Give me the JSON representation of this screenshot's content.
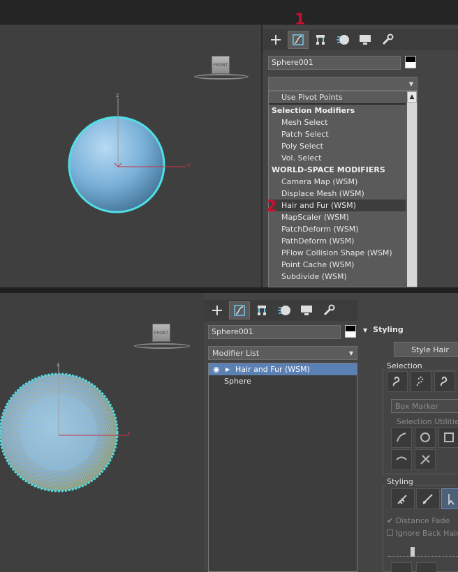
{
  "top": {
    "view_cube_label": "FRONT",
    "axis": {
      "z": "z",
      "x": "x"
    },
    "object_name": "Sphere001",
    "modifier_dropdown_value": "",
    "modifier_list": {
      "items": [
        {
          "label": "Use Pivot Points",
          "type": "item"
        },
        {
          "label": "Selection Modifiers",
          "type": "header"
        },
        {
          "label": "Mesh Select",
          "type": "item"
        },
        {
          "label": "Patch Select",
          "type": "item"
        },
        {
          "label": "Poly Select",
          "type": "item"
        },
        {
          "label": "Vol. Select",
          "type": "item"
        },
        {
          "label": "WORLD-SPACE MODIFIERS",
          "type": "header"
        },
        {
          "label": "Camera Map (WSM)",
          "type": "item"
        },
        {
          "label": "Displace Mesh (WSM)",
          "type": "item"
        },
        {
          "label": "Hair and Fur (WSM)",
          "type": "item",
          "selected": true
        },
        {
          "label": "MapScaler (WSM)",
          "type": "item"
        },
        {
          "label": "PatchDeform (WSM)",
          "type": "item"
        },
        {
          "label": "PathDeform (WSM)",
          "type": "item"
        },
        {
          "label": "PFlow Collision Shape (WSM)",
          "type": "item"
        },
        {
          "label": "Point Cache (WSM)",
          "type": "item"
        },
        {
          "label": "Subdivide (WSM)",
          "type": "item"
        }
      ]
    },
    "marker_1": "1",
    "marker_2": "2"
  },
  "bottom": {
    "view_cube_label": "FRONT",
    "axis": {
      "z": "z",
      "x": "x"
    },
    "object_name": "Sphere001",
    "modifier_dropdown_value": "Modifier List",
    "stack": [
      {
        "label": "Hair and Fur (WSM)",
        "selected": true
      },
      {
        "label": "Sphere",
        "selected": false
      }
    ],
    "styling_rollout": {
      "title": "Styling",
      "style_hair_button": "Style Hair",
      "selection_group": "Selection",
      "box_marker_value": "Box Marker",
      "selection_utilities": "Selection Utilities",
      "styling_group": "Styling",
      "distance_fade": "Distance Fade",
      "ignore_back_hairs": "Ignore Back Hair"
    }
  },
  "colors": {
    "selection_highlight": "#5b80b4",
    "sphere": "#7fb2d9",
    "sphere_outline": "#4fe0e6",
    "marker": "#c8102e"
  }
}
